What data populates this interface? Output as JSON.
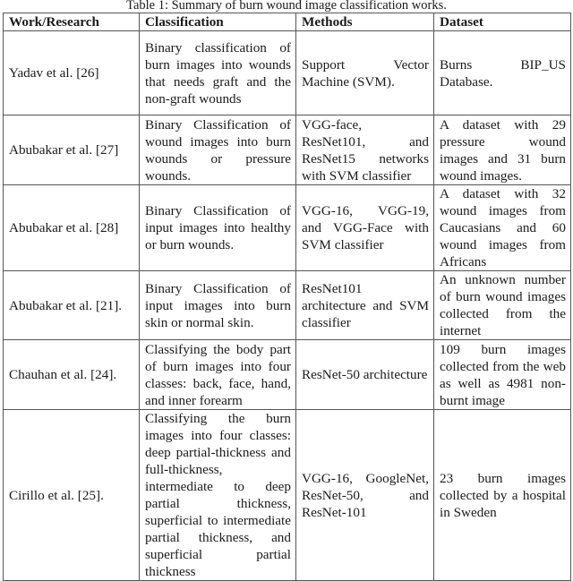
{
  "caption": "Table 1: Summary of burn wound image classification works.",
  "table": {
    "headers": [
      "Work/Research",
      "Classification",
      "Methods",
      "Dataset"
    ],
    "rows": [
      {
        "work": "Yadav et al. [26]",
        "classification": "Binary classification of burn images into wounds that needs graft and the non-graft wounds",
        "methods": "Support Vector Machine (SVM).",
        "dataset": "Burns BIP_US Database."
      },
      {
        "work": "Abubakar et al. [27]",
        "classification": "Binary Classification of wound images into burn wounds or pressure wounds.",
        "methods": "VGG-face, ResNet101, and ResNet15 networks with SVM classifier",
        "dataset": "A dataset with 29 pressure wound images and 31 burn wound images."
      },
      {
        "work": "Abubakar et al. [28]",
        "classification": "Binary Classification of input images into healthy or burn wounds.",
        "methods": "VGG-16, VGG-19, and VGG-Face with SVM classifier",
        "dataset": "A dataset with 32 wound images from Caucasians and 60 wound images from Africans"
      },
      {
        "work": "Abubakar et al. [21].",
        "classification": "Binary Classification of input images into burn skin or normal skin.",
        "methods": "ResNet101 architecture and SVM classifier",
        "dataset": "An unknown number of burn wound images collected from the internet"
      },
      {
        "work": "Chauhan et al. [24].",
        "classification": "Classifying the body part of burn images into four classes: back, face, hand, and inner forearm",
        "methods": "ResNet-50 architecture",
        "dataset": "109 burn images collected from the web as well as 4981 non-burnt image"
      },
      {
        "work": "Cirillo et al. [25].",
        "classification": "Classifying the burn images into four classes: deep partial-thickness and full-thickness, intermediate to deep partial thickness, superficial to intermediate partial thickness, and superficial partial thickness",
        "methods": "VGG-16, GoogleNet, ResNet-50, and ResNet-101",
        "dataset": "23 burn images collected by a hospital in Sweden"
      }
    ]
  }
}
